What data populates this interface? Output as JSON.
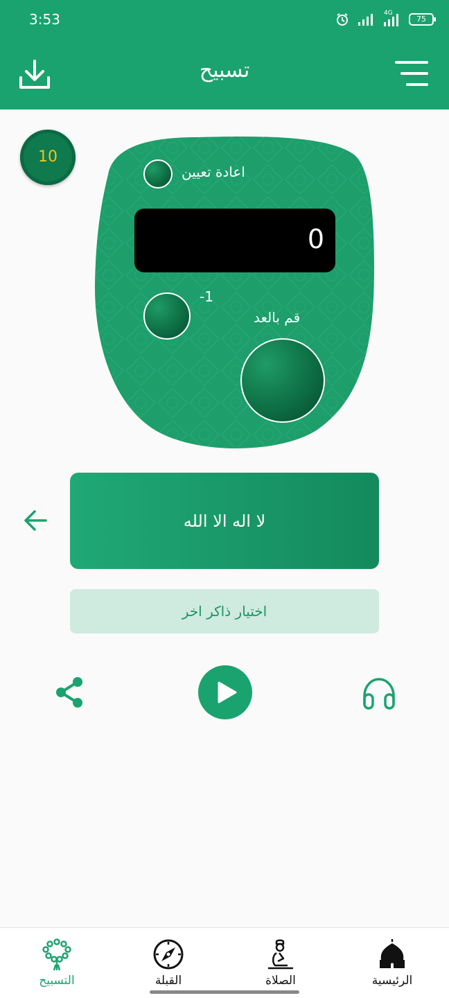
{
  "status_bar": {
    "time": "3:53",
    "network": "4G",
    "battery": "75"
  },
  "header": {
    "title": "تسبيح",
    "download_icon": "download-icon",
    "menu_icon": "menu-icon"
  },
  "level_badge": {
    "value": "10"
  },
  "counter": {
    "reset_label": "اعادة تعيين",
    "display_value": "0",
    "minus_label": "-1",
    "count_label": "قم بالعد"
  },
  "zikr": {
    "text": "لا اله الا الله",
    "back_icon": "arrow-left-icon"
  },
  "choose_button": {
    "label": "اختيار ذاكر اخر"
  },
  "actions": {
    "share_icon": "share-icon",
    "play_icon": "play-icon",
    "listen_icon": "headphones-icon"
  },
  "bottom_nav": {
    "items": [
      {
        "label": "التسبيح",
        "icon": "tasbih-beads-icon",
        "active": true
      },
      {
        "label": "القبلة",
        "icon": "compass-icon",
        "active": false
      },
      {
        "label": "الصلاة",
        "icon": "prayer-icon",
        "active": false
      },
      {
        "label": "الرئيسية",
        "icon": "mosque-icon",
        "active": false
      }
    ]
  },
  "colors": {
    "primary": "#1aa36f",
    "dark": "#0c6b42",
    "badge_text": "#f3c31a",
    "light": "#cfeadf"
  }
}
